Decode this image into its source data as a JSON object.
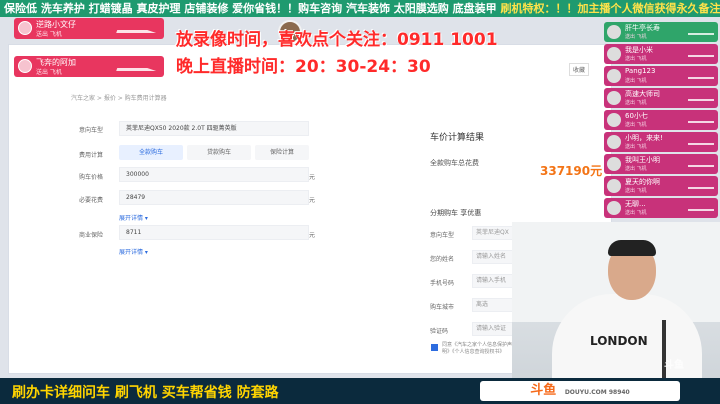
{
  "ticker": {
    "text_white": "保险低 洗车养护 打蜡镀晶 真皮护理 店铺装修 爱你省钱！！购车咨询 汽车装饰 太阳膜选购 底盘装甲 ",
    "text_yellow": "刷机特权：！！加主播个人微信获得永久备注"
  },
  "overlay": {
    "notice_line1": "放录像时间，喜欢点个关注：0911 1001",
    "notice_line2": "晚上直播时间：20：30-24：30",
    "gifts": [
      {
        "user": "逆路小文仔",
        "action": "送出 飞机"
      },
      {
        "user": "飞奔的阿加",
        "action": "送出 飞机"
      }
    ],
    "right_gifts": [
      {
        "user": "肝牛亭长寿",
        "action": "送出 飞机"
      },
      {
        "user": "我是小米",
        "action": "送出 飞机"
      },
      {
        "user": "Pang123",
        "action": "送出 飞机"
      },
      {
        "user": "高速大师司",
        "action": "送出 飞机"
      },
      {
        "user": "60小七",
        "action": "送出 飞机"
      },
      {
        "user": "小明，来来!",
        "action": "送出 飞机"
      },
      {
        "user": "我叫王小明",
        "action": "送出 飞机"
      },
      {
        "user": "夏天的你啊",
        "action": "送出 飞机"
      },
      {
        "user": "无聊...",
        "action": "送出 飞机"
      }
    ]
  },
  "page": {
    "collect": "收藏",
    "breadcrumb": "汽车之家 > 报价 > 购车费用计算器",
    "form": {
      "car_label": "意向车型",
      "car_value": "英菲尼迪QX50 2020款 2.0T 四驱菁英版",
      "mode_label": "费用计算",
      "modes": [
        "全款购车",
        "贷款购车",
        "保险计算"
      ],
      "price_label": "购车价格",
      "price_value": "300000",
      "price_unit": "元",
      "required_label": "必要花费",
      "required_value": "28479",
      "required_unit": "元",
      "expand1": "展开详情 ▾",
      "insurance_label": "商业保险",
      "insurance_value": "8711",
      "insurance_unit": "元",
      "expand2": "展开详情 ▾"
    },
    "result": {
      "title": "车价计算结果",
      "total_label": "全款购车总花费",
      "total_value": "337190元"
    },
    "stage": {
      "title": "分期购车 享优惠",
      "rows": [
        {
          "label": "意向车型",
          "placeholder": "英菲尼迪QX"
        },
        {
          "label": "您的姓名",
          "placeholder": "请输入姓名"
        },
        {
          "label": "手机号码",
          "placeholder": "请输入手机"
        },
        {
          "label": "购车城市",
          "placeholder": "离选"
        },
        {
          "label": "验证码",
          "placeholder": "请输入验证"
        }
      ],
      "agree": "同意《汽车之家个人信息保护声明》《个人信息查询授权书》"
    }
  },
  "webcam": {
    "shirt_print": "LONDON",
    "logo": "斗鱼"
  },
  "banner": {
    "slogan": "刷办卡详细问车     刷飞机 买车帮省钱 防套路",
    "logo": "斗鱼",
    "logo_sub": "DOUYU.COM 98940"
  },
  "colors": {
    "accent": "#2d6cdf",
    "price": "#f37416",
    "notice": "#ff2a2a",
    "banner_text": "#ffd400"
  }
}
